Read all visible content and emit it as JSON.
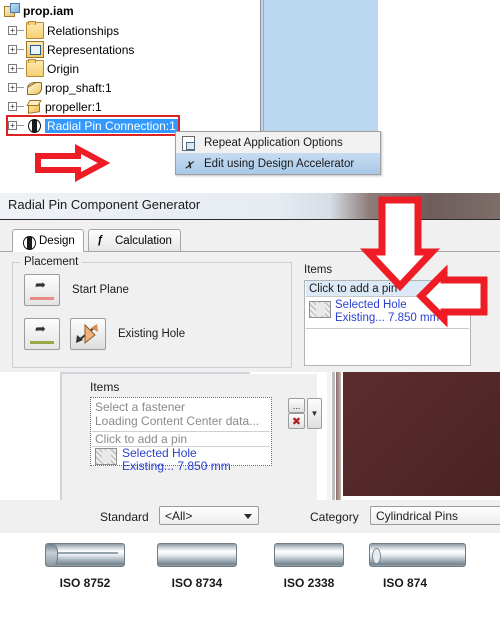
{
  "browser_tree": {
    "root": {
      "label": "prop.iam",
      "icon": "assembly-icon"
    },
    "items": [
      {
        "label": "Relationships",
        "icon": "folder-icon"
      },
      {
        "label": "Representations",
        "icon": "representations-icon"
      },
      {
        "label": "Origin",
        "icon": "folder-icon"
      },
      {
        "label": "prop_shaft:1",
        "icon": "shaft-part-icon"
      },
      {
        "label": "propeller:1",
        "icon": "part-cube-icon"
      },
      {
        "label": "Radial Pin Connection:1",
        "icon": "radial-pin-connection-icon",
        "selected": true
      }
    ]
  },
  "context_menu": {
    "items": [
      {
        "label": "Repeat Application Options",
        "icon": "repeat-icon",
        "highlighted": false
      },
      {
        "label": "Edit using Design Accelerator",
        "icon": "design-accelerator-icon",
        "highlighted": true
      }
    ]
  },
  "dialog": {
    "title": "Radial Pin Component Generator",
    "tabs": [
      {
        "label": "Design",
        "icon": "design-tab-icon",
        "active": true
      },
      {
        "label": "Calculation",
        "icon": "calculation-fx-icon",
        "active": false
      }
    ],
    "placement": {
      "group_title": "Placement",
      "start_plane_label": "Start Plane",
      "existing_hole_label": "Existing Hole"
    },
    "items": {
      "label": "Items",
      "add_pin_row": "Click to add a pin",
      "selected_hole_title": "Selected Hole",
      "selected_hole_value": "Existing... 7.850 mm"
    }
  },
  "dialog_loading": {
    "items_label": "Items",
    "fastener_row1": "Select a fastener",
    "fastener_row2": "Loading Content Center data...",
    "add_pin_row": "Click to add a pin",
    "selected_hole_title": "Selected Hole",
    "selected_hole_value": "Existing... 7.850 mm",
    "browse_button": "...",
    "clear_button": "✖",
    "dropdown_button": "▼"
  },
  "filter_bar": {
    "standard_label": "Standard",
    "standard_value": "<All>",
    "category_label": "Category",
    "category_value": "Cylindrical Pins"
  },
  "pin_gallery": [
    {
      "label": "ISO 8752",
      "style": "slotted"
    },
    {
      "label": "ISO 8734",
      "style": "solid"
    },
    {
      "label": "ISO 2338",
      "style": "solid"
    },
    {
      "label": "ISO 874",
      "style": "tube"
    }
  ],
  "colors": {
    "annotation_red": "#ee1c25",
    "selection_blue": "#3399ff",
    "link_blue": "#2a3fd0",
    "viewport_blue": "#bcd8f0",
    "viewport_maroon": "#5d2d2d"
  }
}
